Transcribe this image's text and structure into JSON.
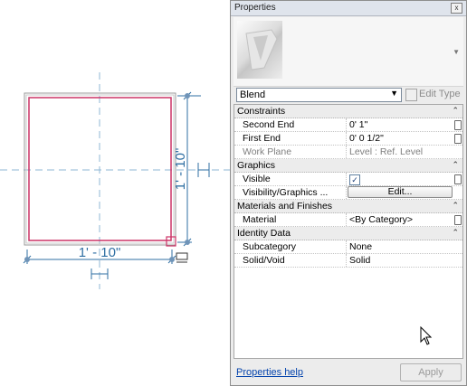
{
  "canvas": {
    "dim_horizontal": "1' - 10\"",
    "dim_vertical": "1' - 10\"",
    "colors": {
      "sketch": "#cc3366",
      "dim": "#2f6fa3",
      "ref": "#8fb7d6",
      "outline": "#8a8a8a"
    }
  },
  "panel": {
    "title": "Properties",
    "close_label": "x",
    "type_selector": {
      "value": "Blend"
    },
    "edit_type_label": "Edit Type",
    "sections": [
      {
        "label": "Constraints",
        "rows": [
          {
            "name": "Second End",
            "value": "0'  1\""
          },
          {
            "name": "First End",
            "value": "0'  0 1/2\""
          },
          {
            "name": "Work Plane",
            "value": "Level : Ref. Level"
          }
        ]
      },
      {
        "label": "Graphics",
        "rows": [
          {
            "name": "Visible",
            "value": "checked"
          },
          {
            "name": "Visibility/Graphics ...",
            "value": "Edit..."
          }
        ]
      },
      {
        "label": "Materials and Finishes",
        "rows": [
          {
            "name": "Material",
            "value": "<By Category>"
          }
        ]
      },
      {
        "label": "Identity Data",
        "rows": [
          {
            "name": "Subcategory",
            "value": "None"
          },
          {
            "name": "Solid/Void",
            "value": "Solid"
          }
        ]
      }
    ],
    "help_link": "Properties help",
    "apply_label": "Apply"
  }
}
